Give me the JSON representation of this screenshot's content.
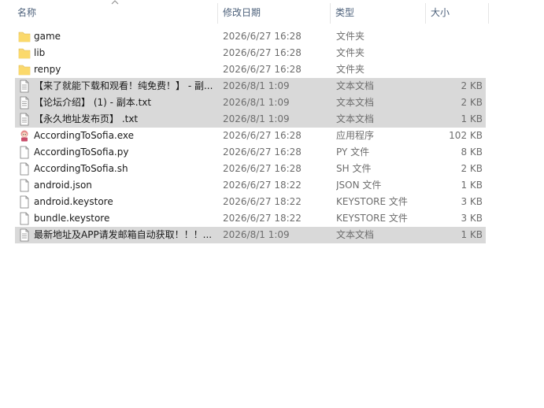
{
  "columns": {
    "name": "名称",
    "date": "修改日期",
    "type": "类型",
    "size": "大小"
  },
  "rows": [
    {
      "name": "game",
      "date": "2026/6/27 16:28",
      "type": "文件夹",
      "size": "",
      "icon": "folder-icon",
      "selected": false
    },
    {
      "name": "lib",
      "date": "2026/6/27 16:28",
      "type": "文件夹",
      "size": "",
      "icon": "folder-icon",
      "selected": false
    },
    {
      "name": "renpy",
      "date": "2026/6/27 16:28",
      "type": "文件夹",
      "size": "",
      "icon": "folder-icon",
      "selected": false
    },
    {
      "name": "【来了就能下载和观看！纯免费！】 - 副...",
      "date": "2026/8/1 1:09",
      "type": "文本文档",
      "size": "2 KB",
      "icon": "text-file-icon",
      "selected": true
    },
    {
      "name": "【论坛介绍】 (1) - 副本.txt",
      "date": "2026/8/1 1:09",
      "type": "文本文档",
      "size": "2 KB",
      "icon": "text-file-icon",
      "selected": true
    },
    {
      "name": "【永久地址发布页】 .txt",
      "date": "2026/8/1 1:09",
      "type": "文本文档",
      "size": "1 KB",
      "icon": "text-file-icon",
      "selected": true
    },
    {
      "name": "AccordingToSofia.exe",
      "date": "2026/6/27 16:28",
      "type": "应用程序",
      "size": "102 KB",
      "icon": "app-icon",
      "selected": false
    },
    {
      "name": "AccordingToSofia.py",
      "date": "2026/6/27 16:28",
      "type": "PY 文件",
      "size": "8 KB",
      "icon": "file-icon",
      "selected": false
    },
    {
      "name": "AccordingToSofia.sh",
      "date": "2026/6/27 16:28",
      "type": "SH 文件",
      "size": "2 KB",
      "icon": "file-icon",
      "selected": false
    },
    {
      "name": "android.json",
      "date": "2026/6/27 18:22",
      "type": "JSON 文件",
      "size": "1 KB",
      "icon": "file-icon",
      "selected": false
    },
    {
      "name": "android.keystore",
      "date": "2026/6/27 18:22",
      "type": "KEYSTORE 文件",
      "size": "3 KB",
      "icon": "file-icon",
      "selected": false
    },
    {
      "name": "bundle.keystore",
      "date": "2026/6/27 18:22",
      "type": "KEYSTORE 文件",
      "size": "3 KB",
      "icon": "file-icon",
      "selected": false
    },
    {
      "name": "最新地址及APP请发邮箱自动获取！！！...",
      "date": "2026/8/1 1:09",
      "type": "文本文档",
      "size": "1 KB",
      "icon": "text-file-icon",
      "selected": true
    }
  ],
  "colors": {
    "selection": "#d9d9d9",
    "header_text": "#4c607a",
    "folder": "#f8d775"
  }
}
